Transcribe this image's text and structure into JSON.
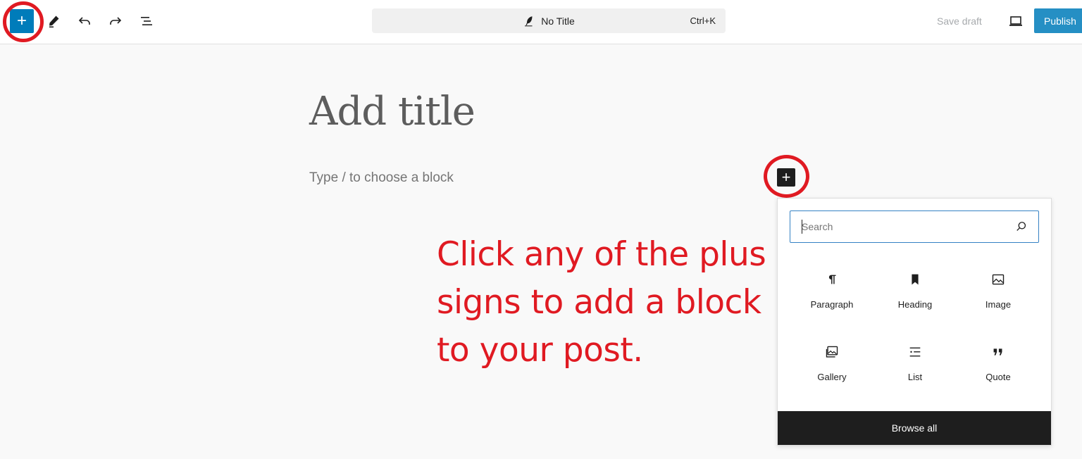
{
  "topbar": {
    "inserter_symbol": "+",
    "tools": [
      {
        "icon": "pencil-icon"
      },
      {
        "icon": "undo-icon"
      },
      {
        "icon": "redo-icon"
      },
      {
        "icon": "list-view-icon"
      }
    ],
    "document": {
      "title": "No Title",
      "shortcut": "Ctrl+K",
      "icon": "feather-icon"
    },
    "save_draft": "Save draft",
    "preview_icon": "laptop-icon",
    "publish": "Publish"
  },
  "editor": {
    "title_placeholder": "Add title",
    "block_placeholder": "Type / to choose a block",
    "inline_inserter_symbol": "+"
  },
  "annotation": {
    "lines": [
      "Click any of the plus",
      "signs to add a block",
      "to your post."
    ],
    "color": "#e01a22"
  },
  "inserter_popover": {
    "search_placeholder": "Search",
    "blocks": [
      {
        "label": "Paragraph",
        "icon": "paragraph-icon"
      },
      {
        "label": "Heading",
        "icon": "bookmark-icon"
      },
      {
        "label": "Image",
        "icon": "image-icon"
      },
      {
        "label": "Gallery",
        "icon": "gallery-icon"
      },
      {
        "label": "List",
        "icon": "list-icon"
      },
      {
        "label": "Quote",
        "icon": "quote-icon"
      }
    ],
    "browse_all": "Browse all"
  },
  "colors": {
    "accent": "#007cba",
    "dark": "#1e1e1e",
    "annotation_red": "#e01a22"
  }
}
